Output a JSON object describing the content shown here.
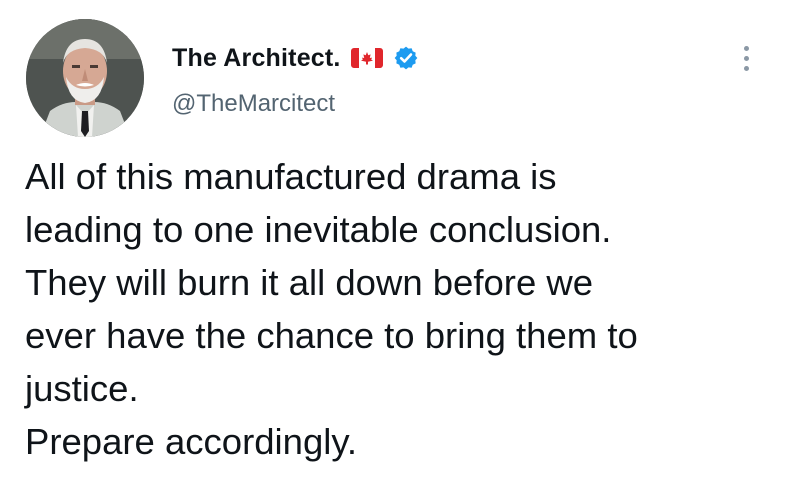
{
  "author": {
    "display_name": "The Architect.",
    "handle": "@TheMarcitect",
    "flag_icon": "canada-flag-icon",
    "verified_icon": "verified-badge-icon",
    "verified_color": "#1d9bf0"
  },
  "tweet": {
    "lines": [
      "All of this manufactured drama is",
      "leading to one inevitable conclusion.",
      "They will burn it all down before we",
      "ever have the chance to bring them to",
      "justice.",
      "Prepare accordingly."
    ]
  },
  "menu": {
    "icon": "more-options-icon"
  },
  "colors": {
    "text": "#0f1419",
    "secondary_text": "#536471",
    "flag_red": "#e0262c"
  }
}
